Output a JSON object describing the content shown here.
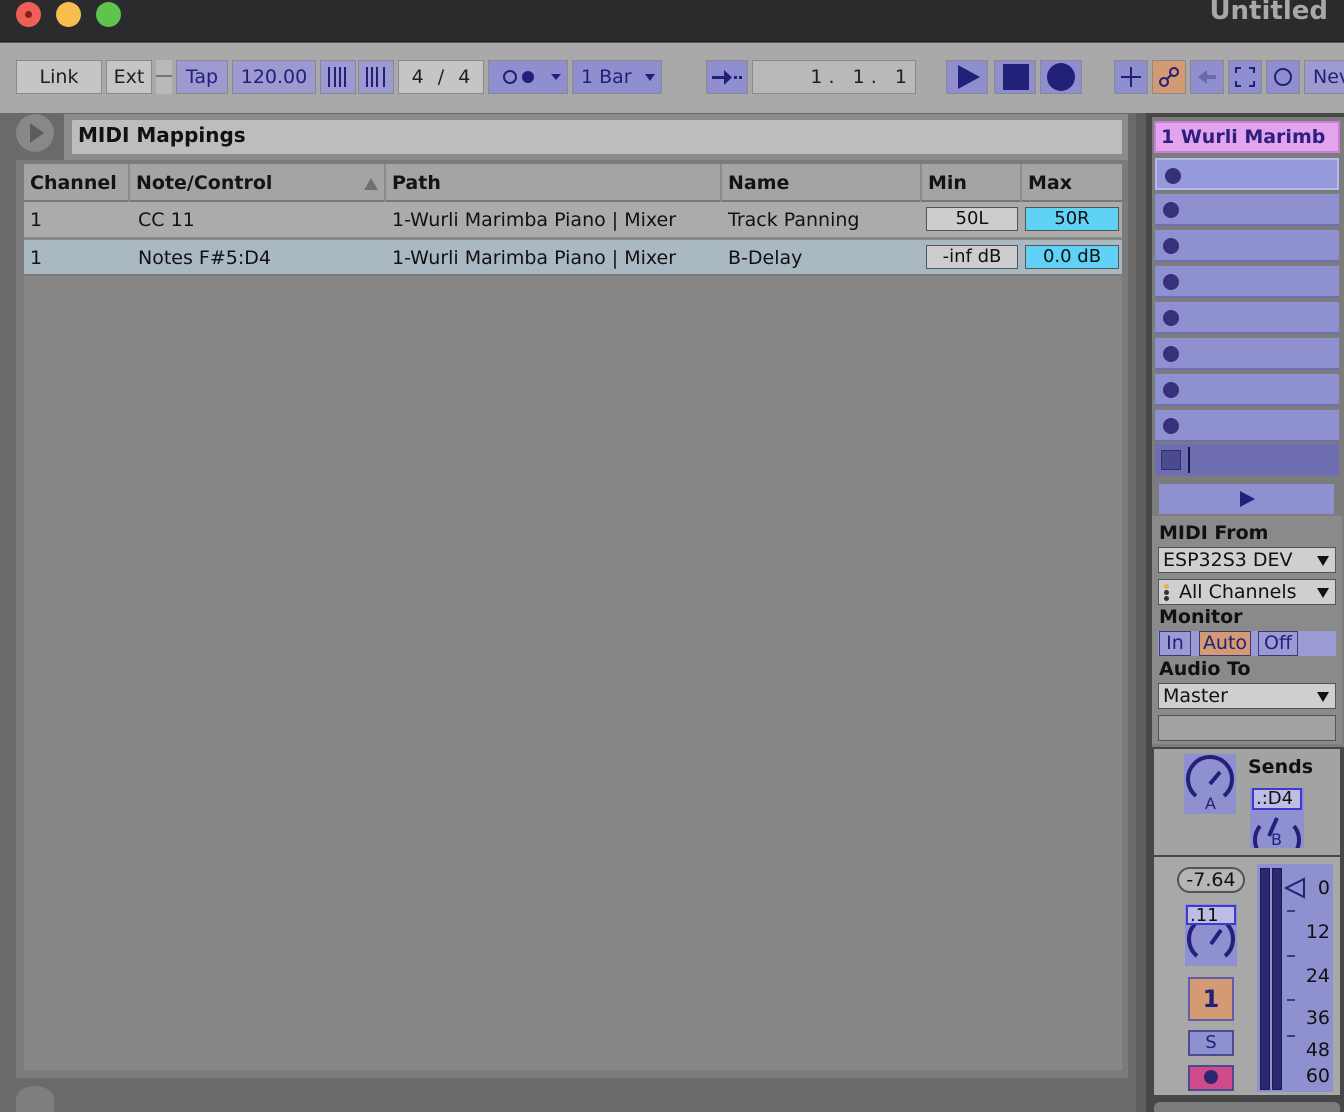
{
  "window": {
    "title": "Untitled"
  },
  "transport": {
    "link": "Link",
    "ext": "Ext",
    "tap": "Tap",
    "tempo": "120.00",
    "sig_num": "4",
    "sig_sep": "/",
    "sig_den": "4",
    "quantize": "1 Bar",
    "position": "1 .   1 .   1",
    "new_label": "Nev"
  },
  "panel": {
    "title": "MIDI Mappings"
  },
  "table": {
    "columns": [
      "Channel",
      "Note/Control",
      "Path",
      "Name",
      "Min",
      "Max"
    ],
    "rows": [
      {
        "channel": "1",
        "note": "CC 11",
        "path": "1-Wurli Marimba Piano | Mixer",
        "name": "Track Panning",
        "min": "50L",
        "max": "50R"
      },
      {
        "channel": "1",
        "note": "Notes F#5:D4",
        "path": "1-Wurli Marimba Piano | Mixer",
        "name": "B-Delay",
        "min": "-inf dB",
        "max": "0.0 dB"
      }
    ]
  },
  "track": {
    "name": "1 Wurli Marimb",
    "midi_from_label": "MIDI From",
    "midi_from": "ESP32S3 DEV",
    "channel": "All Channels",
    "monitor_label": "Monitor",
    "monitor_in": "In",
    "monitor_auto": "Auto",
    "monitor_off": "Off",
    "audio_to_label": "Audio To",
    "audio_to": "Master",
    "sends_label": "Sends",
    "send_a": "A",
    "send_b": "B",
    "send_b_value": ".:D4",
    "volume": "-7.64",
    "pan_value": ".11",
    "track_number": "1",
    "solo": "S",
    "scale": [
      "0",
      "12",
      "24",
      "36",
      "48",
      "60"
    ]
  },
  "colors": {
    "accent_lavender": "#8f90d0",
    "max_value_blue": "#5fd2f5",
    "track_pink": "#e4a3ee",
    "auto_orange": "#d39a73"
  }
}
